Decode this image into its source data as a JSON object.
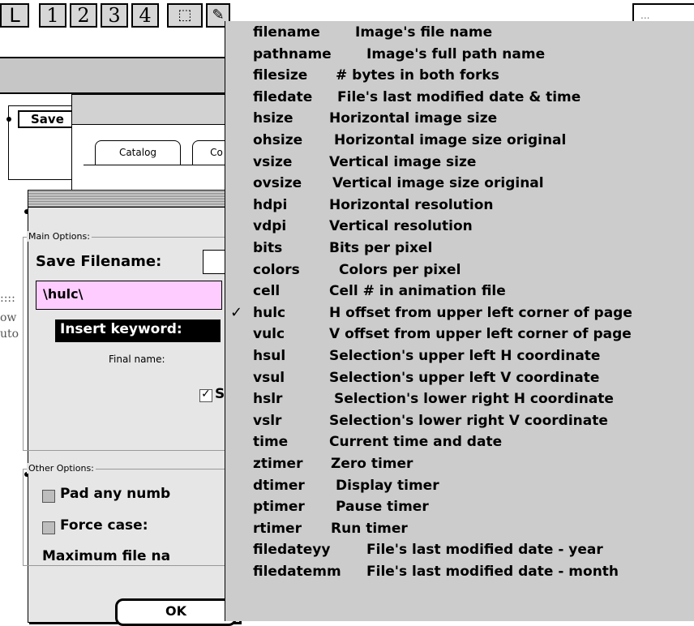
{
  "toolbar": {
    "buttons": [
      "1",
      "2",
      "3",
      "4"
    ],
    "glyph_a": "ᒪ",
    "marquee_label": "⬚",
    "right_hint": "..."
  },
  "save_tab": "Save",
  "tabs": [
    "Catalog",
    "Co"
  ],
  "edge_text": [
    "ow",
    "uto",
    "::::"
  ],
  "dialog": {
    "main_group_label": "Main Options:",
    "save_filename_label": "Save Filename:",
    "pattern_value": "\\hulc\\",
    "insert_keyword_label": "Insert keyword:",
    "final_name_label": "Final name:",
    "s_checkbox_label": "S",
    "other_group_label": "Other Options:",
    "pad_label": "Pad any numb",
    "force_case_label": "Force case:",
    "max_file_label": "Maximum file na",
    "ok_label": "OK"
  },
  "menu": {
    "items": [
      {
        "key": "filename",
        "desc": "Image's file name",
        "checked": false
      },
      {
        "key": "pathname",
        "desc": "Image's full path name",
        "checked": false
      },
      {
        "key": "filesize",
        "desc": "# bytes in both forks",
        "checked": false
      },
      {
        "key": "filedate",
        "desc": "File's last modified date & time",
        "checked": false
      },
      {
        "key": "hsize",
        "desc": "Horizontal image size",
        "checked": false
      },
      {
        "key": "ohsize",
        "desc": "Horizontal image size original",
        "checked": false
      },
      {
        "key": "vsize",
        "desc": "Vertical image size",
        "checked": false
      },
      {
        "key": "ovsize",
        "desc": "Vertical image size original",
        "checked": false
      },
      {
        "key": "hdpi",
        "desc": "Horizontal resolution",
        "checked": false
      },
      {
        "key": "vdpi",
        "desc": "Vertical resolution",
        "checked": false
      },
      {
        "key": "bits",
        "desc": "Bits per pixel",
        "checked": false
      },
      {
        "key": "colors",
        "desc": "Colors per pixel",
        "checked": false
      },
      {
        "key": "cell",
        "desc": "Cell # in animation file",
        "checked": false
      },
      {
        "key": "hulc",
        "desc": "H offset from upper left corner of page",
        "checked": true
      },
      {
        "key": "vulc",
        "desc": "V offset from upper left corner of page",
        "checked": false
      },
      {
        "key": "hsul",
        "desc": "Selection's upper left H coordinate",
        "checked": false
      },
      {
        "key": "vsul",
        "desc": "Selection's upper left V coordinate",
        "checked": false
      },
      {
        "key": "hslr",
        "desc": "Selection's lower right H coordinate",
        "checked": false
      },
      {
        "key": "vslr",
        "desc": "Selection's lower right V coordinate",
        "checked": false
      },
      {
        "key": "time",
        "desc": "Current time and date",
        "checked": false
      },
      {
        "key": "ztimer",
        "desc": "Zero timer",
        "checked": false
      },
      {
        "key": "dtimer",
        "desc": "Display timer",
        "checked": false
      },
      {
        "key": "ptimer",
        "desc": "Pause timer",
        "checked": false
      },
      {
        "key": "rtimer",
        "desc": "Run timer",
        "checked": false
      },
      {
        "key": "filedateyy",
        "desc": "File's last modified date - year",
        "checked": false
      },
      {
        "key": "filedatemm",
        "desc": "File's last modified date - month",
        "checked": false
      }
    ],
    "check_glyph": "✓"
  }
}
